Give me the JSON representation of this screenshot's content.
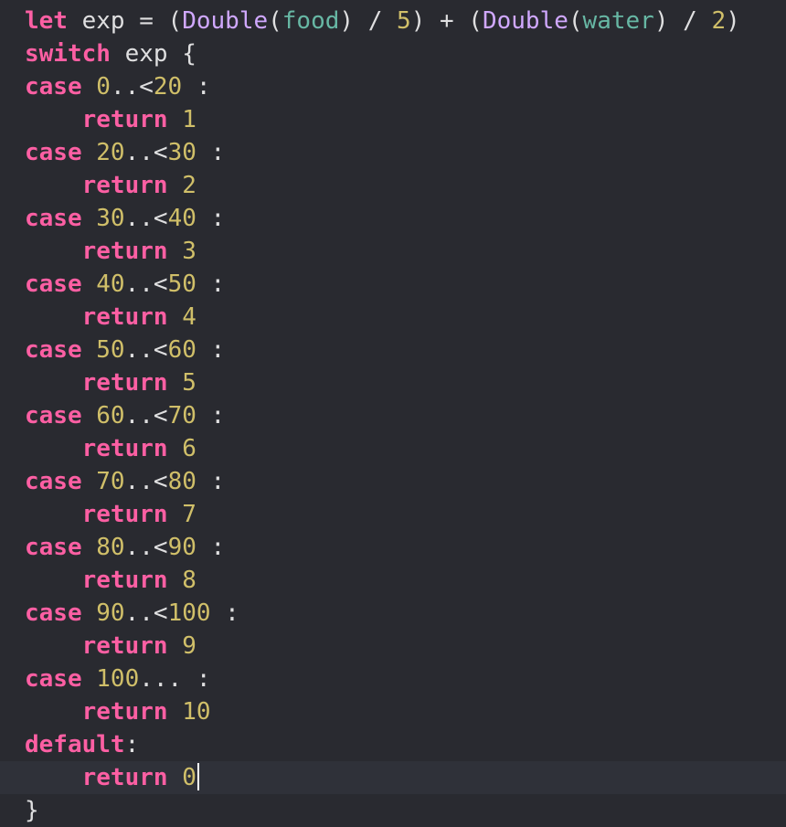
{
  "colors": {
    "background": "#292a30",
    "current_line": "#2f3139",
    "keyword": "#fc5fa3",
    "type": "#d0a8ff",
    "identifier": "#67b7a4",
    "number": "#d0bf69",
    "plain": "#dfdfe0",
    "cursor": "#ffffff"
  },
  "editor": {
    "current_line_index": 23,
    "cursor": {
      "line": 23,
      "after_text": "return 0"
    },
    "lines": [
      [
        {
          "t": "let",
          "c": "kw"
        },
        {
          "t": " exp = (",
          "c": "plain"
        },
        {
          "t": "Double",
          "c": "type"
        },
        {
          "t": "(",
          "c": "plain"
        },
        {
          "t": "food",
          "c": "id"
        },
        {
          "t": ") / ",
          "c": "plain"
        },
        {
          "t": "5",
          "c": "num"
        },
        {
          "t": ") + (",
          "c": "plain"
        },
        {
          "t": "Double",
          "c": "type"
        },
        {
          "t": "(",
          "c": "plain"
        },
        {
          "t": "water",
          "c": "id"
        },
        {
          "t": ") / ",
          "c": "plain"
        },
        {
          "t": "2",
          "c": "num"
        },
        {
          "t": ")",
          "c": "plain"
        }
      ],
      [
        {
          "t": "switch",
          "c": "kw"
        },
        {
          "t": " exp {",
          "c": "plain"
        }
      ],
      [
        {
          "t": "case",
          "c": "kw"
        },
        {
          "t": " ",
          "c": "plain"
        },
        {
          "t": "0",
          "c": "num"
        },
        {
          "t": "..<",
          "c": "plain"
        },
        {
          "t": "20",
          "c": "num"
        },
        {
          "t": " :",
          "c": "plain"
        }
      ],
      [
        {
          "t": "    ",
          "c": "plain"
        },
        {
          "t": "return",
          "c": "kw"
        },
        {
          "t": " ",
          "c": "plain"
        },
        {
          "t": "1",
          "c": "num"
        }
      ],
      [
        {
          "t": "case",
          "c": "kw"
        },
        {
          "t": " ",
          "c": "plain"
        },
        {
          "t": "20",
          "c": "num"
        },
        {
          "t": "..<",
          "c": "plain"
        },
        {
          "t": "30",
          "c": "num"
        },
        {
          "t": " :",
          "c": "plain"
        }
      ],
      [
        {
          "t": "    ",
          "c": "plain"
        },
        {
          "t": "return",
          "c": "kw"
        },
        {
          "t": " ",
          "c": "plain"
        },
        {
          "t": "2",
          "c": "num"
        }
      ],
      [
        {
          "t": "case",
          "c": "kw"
        },
        {
          "t": " ",
          "c": "plain"
        },
        {
          "t": "30",
          "c": "num"
        },
        {
          "t": "..<",
          "c": "plain"
        },
        {
          "t": "40",
          "c": "num"
        },
        {
          "t": " :",
          "c": "plain"
        }
      ],
      [
        {
          "t": "    ",
          "c": "plain"
        },
        {
          "t": "return",
          "c": "kw"
        },
        {
          "t": " ",
          "c": "plain"
        },
        {
          "t": "3",
          "c": "num"
        }
      ],
      [
        {
          "t": "case",
          "c": "kw"
        },
        {
          "t": " ",
          "c": "plain"
        },
        {
          "t": "40",
          "c": "num"
        },
        {
          "t": "..<",
          "c": "plain"
        },
        {
          "t": "50",
          "c": "num"
        },
        {
          "t": " :",
          "c": "plain"
        }
      ],
      [
        {
          "t": "    ",
          "c": "plain"
        },
        {
          "t": "return",
          "c": "kw"
        },
        {
          "t": " ",
          "c": "plain"
        },
        {
          "t": "4",
          "c": "num"
        }
      ],
      [
        {
          "t": "case",
          "c": "kw"
        },
        {
          "t": " ",
          "c": "plain"
        },
        {
          "t": "50",
          "c": "num"
        },
        {
          "t": "..<",
          "c": "plain"
        },
        {
          "t": "60",
          "c": "num"
        },
        {
          "t": " :",
          "c": "plain"
        }
      ],
      [
        {
          "t": "    ",
          "c": "plain"
        },
        {
          "t": "return",
          "c": "kw"
        },
        {
          "t": " ",
          "c": "plain"
        },
        {
          "t": "5",
          "c": "num"
        }
      ],
      [
        {
          "t": "case",
          "c": "kw"
        },
        {
          "t": " ",
          "c": "plain"
        },
        {
          "t": "60",
          "c": "num"
        },
        {
          "t": "..<",
          "c": "plain"
        },
        {
          "t": "70",
          "c": "num"
        },
        {
          "t": " :",
          "c": "plain"
        }
      ],
      [
        {
          "t": "    ",
          "c": "plain"
        },
        {
          "t": "return",
          "c": "kw"
        },
        {
          "t": " ",
          "c": "plain"
        },
        {
          "t": "6",
          "c": "num"
        }
      ],
      [
        {
          "t": "case",
          "c": "kw"
        },
        {
          "t": " ",
          "c": "plain"
        },
        {
          "t": "70",
          "c": "num"
        },
        {
          "t": "..<",
          "c": "plain"
        },
        {
          "t": "80",
          "c": "num"
        },
        {
          "t": " :",
          "c": "plain"
        }
      ],
      [
        {
          "t": "    ",
          "c": "plain"
        },
        {
          "t": "return",
          "c": "kw"
        },
        {
          "t": " ",
          "c": "plain"
        },
        {
          "t": "7",
          "c": "num"
        }
      ],
      [
        {
          "t": "case",
          "c": "kw"
        },
        {
          "t": " ",
          "c": "plain"
        },
        {
          "t": "80",
          "c": "num"
        },
        {
          "t": "..<",
          "c": "plain"
        },
        {
          "t": "90",
          "c": "num"
        },
        {
          "t": " :",
          "c": "plain"
        }
      ],
      [
        {
          "t": "    ",
          "c": "plain"
        },
        {
          "t": "return",
          "c": "kw"
        },
        {
          "t": " ",
          "c": "plain"
        },
        {
          "t": "8",
          "c": "num"
        }
      ],
      [
        {
          "t": "case",
          "c": "kw"
        },
        {
          "t": " ",
          "c": "plain"
        },
        {
          "t": "90",
          "c": "num"
        },
        {
          "t": "..<",
          "c": "plain"
        },
        {
          "t": "100",
          "c": "num"
        },
        {
          "t": " :",
          "c": "plain"
        }
      ],
      [
        {
          "t": "    ",
          "c": "plain"
        },
        {
          "t": "return",
          "c": "kw"
        },
        {
          "t": " ",
          "c": "plain"
        },
        {
          "t": "9",
          "c": "num"
        }
      ],
      [
        {
          "t": "case",
          "c": "kw"
        },
        {
          "t": " ",
          "c": "plain"
        },
        {
          "t": "100",
          "c": "num"
        },
        {
          "t": "... :",
          "c": "plain"
        }
      ],
      [
        {
          "t": "    ",
          "c": "plain"
        },
        {
          "t": "return",
          "c": "kw"
        },
        {
          "t": " ",
          "c": "plain"
        },
        {
          "t": "10",
          "c": "num"
        }
      ],
      [
        {
          "t": "default",
          "c": "kw"
        },
        {
          "t": ":",
          "c": "plain"
        }
      ],
      [
        {
          "t": "    ",
          "c": "plain"
        },
        {
          "t": "return",
          "c": "kw"
        },
        {
          "t": " ",
          "c": "plain"
        },
        {
          "t": "0",
          "c": "num"
        }
      ],
      [
        {
          "t": "}",
          "c": "plain"
        }
      ]
    ]
  }
}
